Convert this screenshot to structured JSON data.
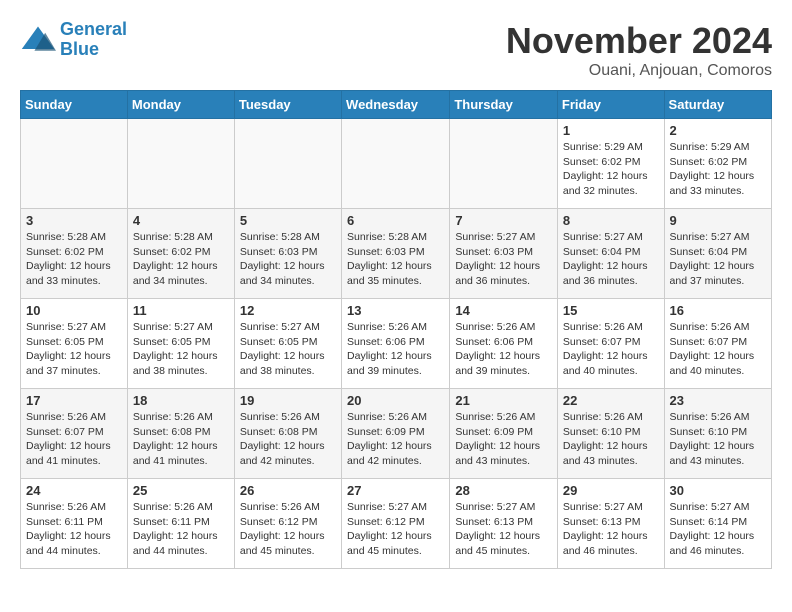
{
  "logo": {
    "line1": "General",
    "line2": "Blue"
  },
  "title": "November 2024",
  "location": "Ouani, Anjouan, Comoros",
  "days_of_week": [
    "Sunday",
    "Monday",
    "Tuesday",
    "Wednesday",
    "Thursday",
    "Friday",
    "Saturday"
  ],
  "weeks": [
    [
      {
        "day": "",
        "info": ""
      },
      {
        "day": "",
        "info": ""
      },
      {
        "day": "",
        "info": ""
      },
      {
        "day": "",
        "info": ""
      },
      {
        "day": "",
        "info": ""
      },
      {
        "day": "1",
        "info": "Sunrise: 5:29 AM\nSunset: 6:02 PM\nDaylight: 12 hours and 32 minutes."
      },
      {
        "day": "2",
        "info": "Sunrise: 5:29 AM\nSunset: 6:02 PM\nDaylight: 12 hours and 33 minutes."
      }
    ],
    [
      {
        "day": "3",
        "info": "Sunrise: 5:28 AM\nSunset: 6:02 PM\nDaylight: 12 hours and 33 minutes."
      },
      {
        "day": "4",
        "info": "Sunrise: 5:28 AM\nSunset: 6:02 PM\nDaylight: 12 hours and 34 minutes."
      },
      {
        "day": "5",
        "info": "Sunrise: 5:28 AM\nSunset: 6:03 PM\nDaylight: 12 hours and 34 minutes."
      },
      {
        "day": "6",
        "info": "Sunrise: 5:28 AM\nSunset: 6:03 PM\nDaylight: 12 hours and 35 minutes."
      },
      {
        "day": "7",
        "info": "Sunrise: 5:27 AM\nSunset: 6:03 PM\nDaylight: 12 hours and 36 minutes."
      },
      {
        "day": "8",
        "info": "Sunrise: 5:27 AM\nSunset: 6:04 PM\nDaylight: 12 hours and 36 minutes."
      },
      {
        "day": "9",
        "info": "Sunrise: 5:27 AM\nSunset: 6:04 PM\nDaylight: 12 hours and 37 minutes."
      }
    ],
    [
      {
        "day": "10",
        "info": "Sunrise: 5:27 AM\nSunset: 6:05 PM\nDaylight: 12 hours and 37 minutes."
      },
      {
        "day": "11",
        "info": "Sunrise: 5:27 AM\nSunset: 6:05 PM\nDaylight: 12 hours and 38 minutes."
      },
      {
        "day": "12",
        "info": "Sunrise: 5:27 AM\nSunset: 6:05 PM\nDaylight: 12 hours and 38 minutes."
      },
      {
        "day": "13",
        "info": "Sunrise: 5:26 AM\nSunset: 6:06 PM\nDaylight: 12 hours and 39 minutes."
      },
      {
        "day": "14",
        "info": "Sunrise: 5:26 AM\nSunset: 6:06 PM\nDaylight: 12 hours and 39 minutes."
      },
      {
        "day": "15",
        "info": "Sunrise: 5:26 AM\nSunset: 6:07 PM\nDaylight: 12 hours and 40 minutes."
      },
      {
        "day": "16",
        "info": "Sunrise: 5:26 AM\nSunset: 6:07 PM\nDaylight: 12 hours and 40 minutes."
      }
    ],
    [
      {
        "day": "17",
        "info": "Sunrise: 5:26 AM\nSunset: 6:07 PM\nDaylight: 12 hours and 41 minutes."
      },
      {
        "day": "18",
        "info": "Sunrise: 5:26 AM\nSunset: 6:08 PM\nDaylight: 12 hours and 41 minutes."
      },
      {
        "day": "19",
        "info": "Sunrise: 5:26 AM\nSunset: 6:08 PM\nDaylight: 12 hours and 42 minutes."
      },
      {
        "day": "20",
        "info": "Sunrise: 5:26 AM\nSunset: 6:09 PM\nDaylight: 12 hours and 42 minutes."
      },
      {
        "day": "21",
        "info": "Sunrise: 5:26 AM\nSunset: 6:09 PM\nDaylight: 12 hours and 43 minutes."
      },
      {
        "day": "22",
        "info": "Sunrise: 5:26 AM\nSunset: 6:10 PM\nDaylight: 12 hours and 43 minutes."
      },
      {
        "day": "23",
        "info": "Sunrise: 5:26 AM\nSunset: 6:10 PM\nDaylight: 12 hours and 43 minutes."
      }
    ],
    [
      {
        "day": "24",
        "info": "Sunrise: 5:26 AM\nSunset: 6:11 PM\nDaylight: 12 hours and 44 minutes."
      },
      {
        "day": "25",
        "info": "Sunrise: 5:26 AM\nSunset: 6:11 PM\nDaylight: 12 hours and 44 minutes."
      },
      {
        "day": "26",
        "info": "Sunrise: 5:26 AM\nSunset: 6:12 PM\nDaylight: 12 hours and 45 minutes."
      },
      {
        "day": "27",
        "info": "Sunrise: 5:27 AM\nSunset: 6:12 PM\nDaylight: 12 hours and 45 minutes."
      },
      {
        "day": "28",
        "info": "Sunrise: 5:27 AM\nSunset: 6:13 PM\nDaylight: 12 hours and 45 minutes."
      },
      {
        "day": "29",
        "info": "Sunrise: 5:27 AM\nSunset: 6:13 PM\nDaylight: 12 hours and 46 minutes."
      },
      {
        "day": "30",
        "info": "Sunrise: 5:27 AM\nSunset: 6:14 PM\nDaylight: 12 hours and 46 minutes."
      }
    ]
  ]
}
